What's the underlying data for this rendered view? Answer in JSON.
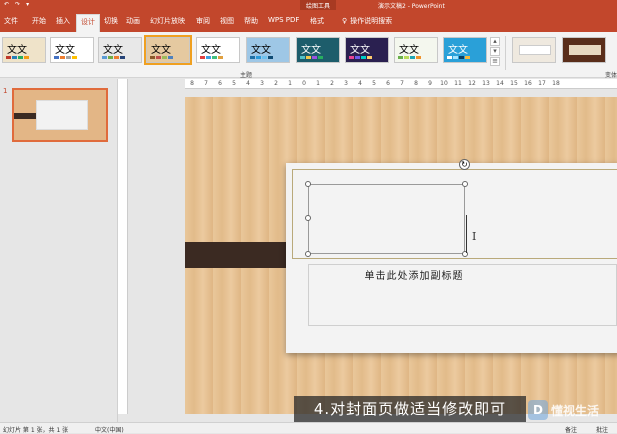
{
  "titlebar": {
    "quick_access": [
      "↶",
      "↷",
      "▾"
    ],
    "context_tab": "绘图工具",
    "document_title": "演示文稿2 - PowerPoint"
  },
  "tabs": [
    "文件",
    "开始",
    "插入",
    "设计",
    "切换",
    "动画",
    "幻灯片放映",
    "审阅",
    "视图",
    "帮助",
    "WPS PDF",
    "格式"
  ],
  "active_tab": "设计",
  "tell_me": "操作说明搜索",
  "ribbon": {
    "themes": [
      {
        "label": "文文",
        "bg": "#efe3c9",
        "selected": false
      },
      {
        "label": "文文",
        "bg": "#ffffff",
        "selected": false
      },
      {
        "label": "文文",
        "bg": "#e8e8e8",
        "selected": false
      },
      {
        "label": "文文",
        "bg": "#e5c9a0",
        "selected": true
      },
      {
        "label": "文文",
        "bg": "#ffffff",
        "selected": false
      },
      {
        "label": "文文",
        "bg": "#9ec7e6",
        "selected": false
      },
      {
        "label": "文文",
        "bg": "#1d5d6b",
        "selected": false
      },
      {
        "label": "文文",
        "bg": "#2a2050",
        "selected": false
      },
      {
        "label": "文文",
        "bg": "#f4f7ee",
        "selected": false
      },
      {
        "label": "文文",
        "bg": "#2aa0d8",
        "selected": false
      }
    ],
    "group_label": "主题",
    "variants_label": "变体"
  },
  "slides_panel": {
    "slide_number": "1"
  },
  "ruler_ticks": [
    "8",
    "7",
    "6",
    "5",
    "4",
    "3",
    "2",
    "1",
    "0",
    "1",
    "2",
    "3",
    "4",
    "5",
    "6",
    "7",
    "8",
    "9",
    "10",
    "11",
    "12",
    "13",
    "14",
    "15",
    "16",
    "17",
    "18"
  ],
  "slide": {
    "subtitle_placeholder": "单击此处添加副标题",
    "ibeam": "I",
    "rotate_glyph": "↻"
  },
  "caption": "4.对封面页做适当修改即可",
  "watermark": {
    "text": "懂视生活",
    "logo_glyph": "D"
  },
  "status": {
    "slide_info": "幻灯片 第 1 张，共 1 张",
    "language": "中文(中国)",
    "notes": "备注",
    "comments": "批注"
  },
  "colors": {
    "accent": "#c2472c",
    "wood": "#e6c194",
    "brace": "#3b2a22"
  }
}
